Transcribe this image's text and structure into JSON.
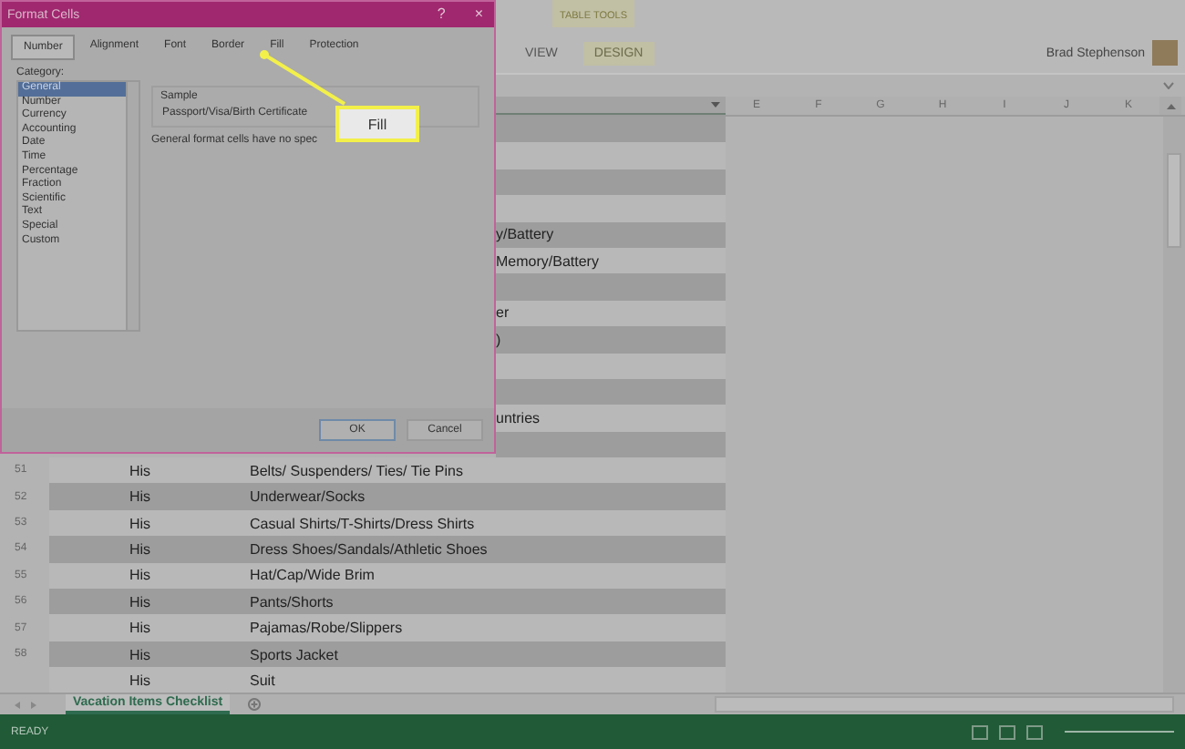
{
  "ribbon": {
    "contextual_group": "TABLE TOOLS",
    "tabs": [
      {
        "label": "VIEW",
        "selected": false
      },
      {
        "label": "DESIGN",
        "selected": false
      }
    ],
    "user": "Brad Stephenson"
  },
  "columns": [
    "E",
    "F",
    "G",
    "H",
    "I",
    "J",
    "K"
  ],
  "rows": [
    {
      "kind": "covered",
      "shaded": true
    },
    {
      "kind": "covered",
      "shaded": false
    },
    {
      "kind": "covered",
      "shaded": true
    },
    {
      "kind": "covered",
      "shaded": false
    },
    {
      "kind": "covered",
      "shaded": true,
      "item": "y/Battery"
    },
    {
      "kind": "covered",
      "shaded": false,
      "item": "Memory/Battery"
    },
    {
      "kind": "covered",
      "shaded": true
    },
    {
      "kind": "covered",
      "shaded": false,
      "item": "er"
    },
    {
      "kind": "covered",
      "shaded": true,
      "item": ")"
    },
    {
      "kind": "covered",
      "shaded": false
    },
    {
      "kind": "covered",
      "shaded": true
    },
    {
      "kind": "covered",
      "shaded": false,
      "item": "untries"
    },
    {
      "kind": "covered",
      "shaded": true
    },
    {
      "kind": "full",
      "shaded": false,
      "number": "51",
      "owner": "His",
      "item": "Belts/ Suspenders/ Ties/ Tie Pins"
    },
    {
      "kind": "full",
      "shaded": true,
      "number": "52",
      "owner": "His",
      "item": "Underwear/Socks"
    },
    {
      "kind": "full",
      "shaded": false,
      "number": "53",
      "owner": "His",
      "item": "Casual Shirts/T-Shirts/Dress Shirts"
    },
    {
      "kind": "full",
      "shaded": true,
      "number": "54",
      "owner": "His",
      "item": "Dress Shoes/Sandals/Athletic Shoes"
    },
    {
      "kind": "full",
      "shaded": false,
      "number": "55",
      "owner": "His",
      "item": "Hat/Cap/Wide Brim"
    },
    {
      "kind": "full",
      "shaded": true,
      "number": "56",
      "owner": "His",
      "item": "Pants/Shorts"
    },
    {
      "kind": "full",
      "shaded": false,
      "number": "57",
      "owner": "His",
      "item": "Pajamas/Robe/Slippers"
    },
    {
      "kind": "full",
      "shaded": true,
      "number": "58",
      "owner": "His",
      "item": "Sports Jacket"
    },
    {
      "kind": "full",
      "shaded": false,
      "owner": "His",
      "item": "Suit"
    }
  ],
  "sheet_tabs": [
    {
      "label": "Vacation Items Checklist",
      "selected": true
    }
  ],
  "status_bar": {
    "text": "READY"
  },
  "dialog": {
    "title": "Format Cells",
    "help": "?",
    "close": "×",
    "tabs": [
      {
        "label": "Number",
        "selected": true
      },
      {
        "label": "Alignment",
        "selected": false
      },
      {
        "label": "Font",
        "selected": false
      },
      {
        "label": "Border",
        "selected": false
      },
      {
        "label": "Fill",
        "selected": false
      },
      {
        "label": "Protection",
        "selected": false
      }
    ],
    "category_label": "Category:",
    "categories": [
      {
        "label": "General",
        "selected": true
      },
      {
        "label": "Number",
        "selected": false
      },
      {
        "label": "Currency",
        "selected": false
      },
      {
        "label": "Accounting",
        "selected": false
      },
      {
        "label": "Date",
        "selected": false
      },
      {
        "label": "Time",
        "selected": false
      },
      {
        "label": "Percentage",
        "selected": false
      },
      {
        "label": "Fraction",
        "selected": false
      },
      {
        "label": "Scientific",
        "selected": false
      },
      {
        "label": "Text",
        "selected": false
      },
      {
        "label": "Special",
        "selected": false
      },
      {
        "label": "Custom",
        "selected": false
      }
    ],
    "sample_label": "Sample",
    "sample_value": "Passport/Visa/Birth Certificate",
    "description": "General format cells have no spec",
    "buttons": [
      {
        "label": "OK",
        "default": true
      },
      {
        "label": "Cancel",
        "default": false
      }
    ]
  },
  "callout": {
    "text": "Fill"
  }
}
